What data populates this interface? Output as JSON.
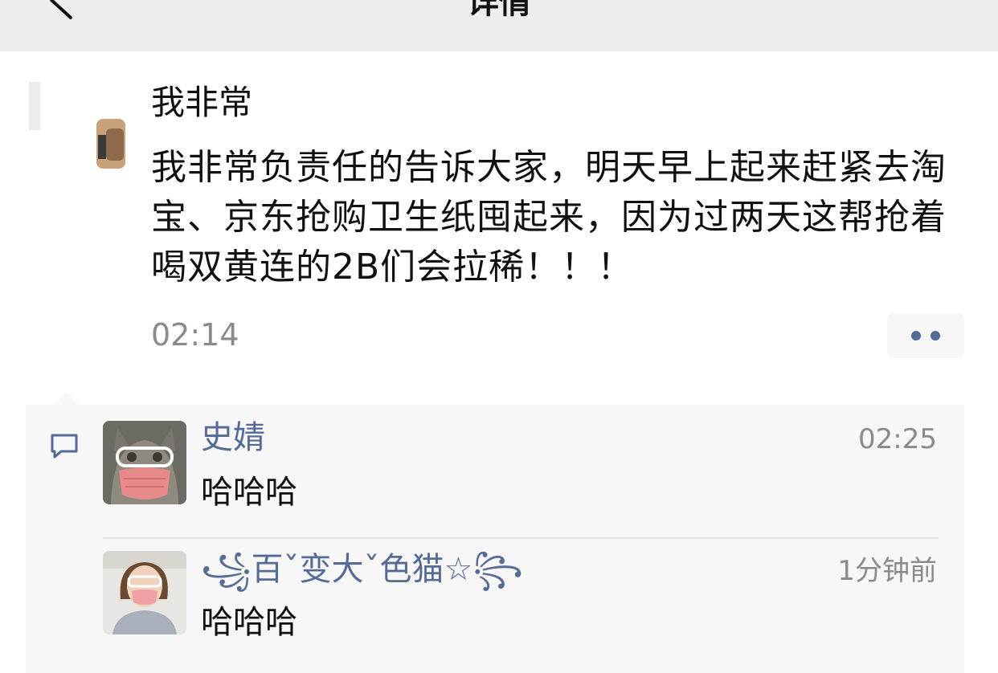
{
  "nav": {
    "title": "详情"
  },
  "post": {
    "author": "我非常",
    "content": "我非常负责任的告诉大家，明天早上起来赶紧去淘宝、京东抢购卫生纸囤起来，因为过两天这帮抢着喝双黄连的2B们会拉稀！！！",
    "time": "02:14"
  },
  "comments": [
    {
      "name": "史婧",
      "text": "哈哈哈",
      "time": "02:25"
    },
    {
      "name": "꧁百ˇ变大ˇ色猫☆꧂",
      "text": "哈哈哈",
      "time": "1分钟前"
    }
  ],
  "colors": {
    "nav_background": "#ededed",
    "link_name": "#566b94",
    "muted_text": "#8a8a8a",
    "panel_background": "#f7f7f7"
  },
  "icons": {
    "back": "chevron-left-icon",
    "more": "more-dots-icon",
    "comment": "comment-bubble-icon"
  }
}
